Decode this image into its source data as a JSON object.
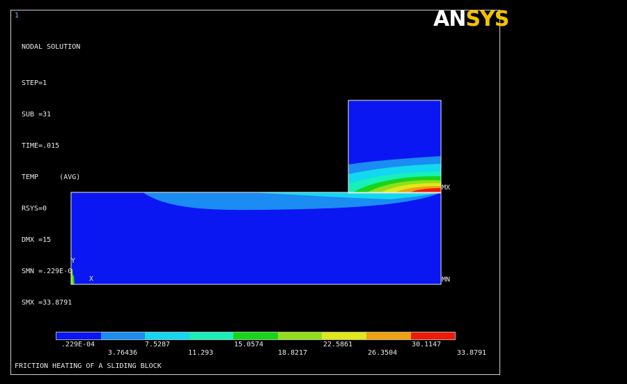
{
  "window": {
    "number": "1"
  },
  "logo": {
    "part1": "AN",
    "part2": "SYS"
  },
  "info": {
    "title": "NODAL SOLUTION",
    "lines": [
      "STEP=1",
      "SUB =31",
      "TIME=.015",
      "TEMP     (AVG)",
      "RSYS=0",
      "DMX =15",
      "SMN =.229E-04",
      "SMX =33.8791"
    ]
  },
  "plot_labels": {
    "mx": "MX",
    "mn": "MN",
    "axis_y": "Y",
    "axis_x": "X"
  },
  "legend": {
    "colors": [
      "#0a17f2",
      "#1a8cf2",
      "#12d8f0",
      "#17f0b8",
      "#19d419",
      "#8fe01a",
      "#e0e81a",
      "#f0a010",
      "#f01a0a"
    ],
    "ticks_top": [
      ".229E-04",
      "7.5287",
      "15.0574",
      "22.5861",
      "30.1147"
    ],
    "ticks_bottom": [
      "3.76436",
      "11.293",
      "18.8217",
      "26.3504",
      "33.8791"
    ]
  },
  "footer": {
    "title": "FRICTION HEATING OF A SLIDING BLOCK"
  }
}
